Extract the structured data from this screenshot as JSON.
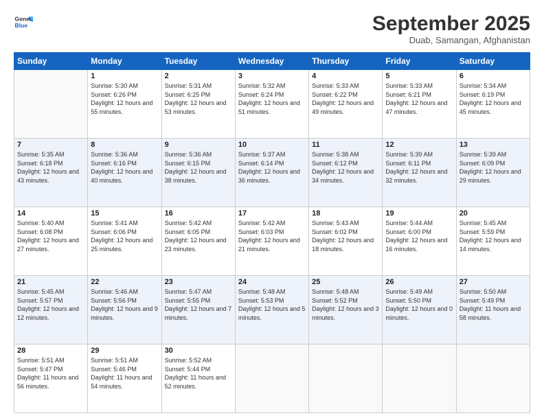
{
  "header": {
    "logo_general": "General",
    "logo_blue": "Blue",
    "month": "September 2025",
    "location": "Duab, Samangan, Afghanistan"
  },
  "weekdays": [
    "Sunday",
    "Monday",
    "Tuesday",
    "Wednesday",
    "Thursday",
    "Friday",
    "Saturday"
  ],
  "weeks": [
    [
      {
        "day": "",
        "sunrise": "",
        "sunset": "",
        "daylight": ""
      },
      {
        "day": "1",
        "sunrise": "Sunrise: 5:30 AM",
        "sunset": "Sunset: 6:26 PM",
        "daylight": "Daylight: 12 hours and 55 minutes."
      },
      {
        "day": "2",
        "sunrise": "Sunrise: 5:31 AM",
        "sunset": "Sunset: 6:25 PM",
        "daylight": "Daylight: 12 hours and 53 minutes."
      },
      {
        "day": "3",
        "sunrise": "Sunrise: 5:32 AM",
        "sunset": "Sunset: 6:24 PM",
        "daylight": "Daylight: 12 hours and 51 minutes."
      },
      {
        "day": "4",
        "sunrise": "Sunrise: 5:33 AM",
        "sunset": "Sunset: 6:22 PM",
        "daylight": "Daylight: 12 hours and 49 minutes."
      },
      {
        "day": "5",
        "sunrise": "Sunrise: 5:33 AM",
        "sunset": "Sunset: 6:21 PM",
        "daylight": "Daylight: 12 hours and 47 minutes."
      },
      {
        "day": "6",
        "sunrise": "Sunrise: 5:34 AM",
        "sunset": "Sunset: 6:19 PM",
        "daylight": "Daylight: 12 hours and 45 minutes."
      }
    ],
    [
      {
        "day": "7",
        "sunrise": "Sunrise: 5:35 AM",
        "sunset": "Sunset: 6:18 PM",
        "daylight": "Daylight: 12 hours and 43 minutes."
      },
      {
        "day": "8",
        "sunrise": "Sunrise: 5:36 AM",
        "sunset": "Sunset: 6:16 PM",
        "daylight": "Daylight: 12 hours and 40 minutes."
      },
      {
        "day": "9",
        "sunrise": "Sunrise: 5:36 AM",
        "sunset": "Sunset: 6:15 PM",
        "daylight": "Daylight: 12 hours and 38 minutes."
      },
      {
        "day": "10",
        "sunrise": "Sunrise: 5:37 AM",
        "sunset": "Sunset: 6:14 PM",
        "daylight": "Daylight: 12 hours and 36 minutes."
      },
      {
        "day": "11",
        "sunrise": "Sunrise: 5:38 AM",
        "sunset": "Sunset: 6:12 PM",
        "daylight": "Daylight: 12 hours and 34 minutes."
      },
      {
        "day": "12",
        "sunrise": "Sunrise: 5:39 AM",
        "sunset": "Sunset: 6:11 PM",
        "daylight": "Daylight: 12 hours and 32 minutes."
      },
      {
        "day": "13",
        "sunrise": "Sunrise: 5:39 AM",
        "sunset": "Sunset: 6:09 PM",
        "daylight": "Daylight: 12 hours and 29 minutes."
      }
    ],
    [
      {
        "day": "14",
        "sunrise": "Sunrise: 5:40 AM",
        "sunset": "Sunset: 6:08 PM",
        "daylight": "Daylight: 12 hours and 27 minutes."
      },
      {
        "day": "15",
        "sunrise": "Sunrise: 5:41 AM",
        "sunset": "Sunset: 6:06 PM",
        "daylight": "Daylight: 12 hours and 25 minutes."
      },
      {
        "day": "16",
        "sunrise": "Sunrise: 5:42 AM",
        "sunset": "Sunset: 6:05 PM",
        "daylight": "Daylight: 12 hours and 23 minutes."
      },
      {
        "day": "17",
        "sunrise": "Sunrise: 5:42 AM",
        "sunset": "Sunset: 6:03 PM",
        "daylight": "Daylight: 12 hours and 21 minutes."
      },
      {
        "day": "18",
        "sunrise": "Sunrise: 5:43 AM",
        "sunset": "Sunset: 6:02 PM",
        "daylight": "Daylight: 12 hours and 18 minutes."
      },
      {
        "day": "19",
        "sunrise": "Sunrise: 5:44 AM",
        "sunset": "Sunset: 6:00 PM",
        "daylight": "Daylight: 12 hours and 16 minutes."
      },
      {
        "day": "20",
        "sunrise": "Sunrise: 5:45 AM",
        "sunset": "Sunset: 5:59 PM",
        "daylight": "Daylight: 12 hours and 14 minutes."
      }
    ],
    [
      {
        "day": "21",
        "sunrise": "Sunrise: 5:45 AM",
        "sunset": "Sunset: 5:57 PM",
        "daylight": "Daylight: 12 hours and 12 minutes."
      },
      {
        "day": "22",
        "sunrise": "Sunrise: 5:46 AM",
        "sunset": "Sunset: 5:56 PM",
        "daylight": "Daylight: 12 hours and 9 minutes."
      },
      {
        "day": "23",
        "sunrise": "Sunrise: 5:47 AM",
        "sunset": "Sunset: 5:55 PM",
        "daylight": "Daylight: 12 hours and 7 minutes."
      },
      {
        "day": "24",
        "sunrise": "Sunrise: 5:48 AM",
        "sunset": "Sunset: 5:53 PM",
        "daylight": "Daylight: 12 hours and 5 minutes."
      },
      {
        "day": "25",
        "sunrise": "Sunrise: 5:48 AM",
        "sunset": "Sunset: 5:52 PM",
        "daylight": "Daylight: 12 hours and 3 minutes."
      },
      {
        "day": "26",
        "sunrise": "Sunrise: 5:49 AM",
        "sunset": "Sunset: 5:50 PM",
        "daylight": "Daylight: 12 hours and 0 minutes."
      },
      {
        "day": "27",
        "sunrise": "Sunrise: 5:50 AM",
        "sunset": "Sunset: 5:49 PM",
        "daylight": "Daylight: 11 hours and 58 minutes."
      }
    ],
    [
      {
        "day": "28",
        "sunrise": "Sunrise: 5:51 AM",
        "sunset": "Sunset: 5:47 PM",
        "daylight": "Daylight: 11 hours and 56 minutes."
      },
      {
        "day": "29",
        "sunrise": "Sunrise: 5:51 AM",
        "sunset": "Sunset: 5:46 PM",
        "daylight": "Daylight: 11 hours and 54 minutes."
      },
      {
        "day": "30",
        "sunrise": "Sunrise: 5:52 AM",
        "sunset": "Sunset: 5:44 PM",
        "daylight": "Daylight: 11 hours and 52 minutes."
      },
      {
        "day": "",
        "sunrise": "",
        "sunset": "",
        "daylight": ""
      },
      {
        "day": "",
        "sunrise": "",
        "sunset": "",
        "daylight": ""
      },
      {
        "day": "",
        "sunrise": "",
        "sunset": "",
        "daylight": ""
      },
      {
        "day": "",
        "sunrise": "",
        "sunset": "",
        "daylight": ""
      }
    ]
  ]
}
